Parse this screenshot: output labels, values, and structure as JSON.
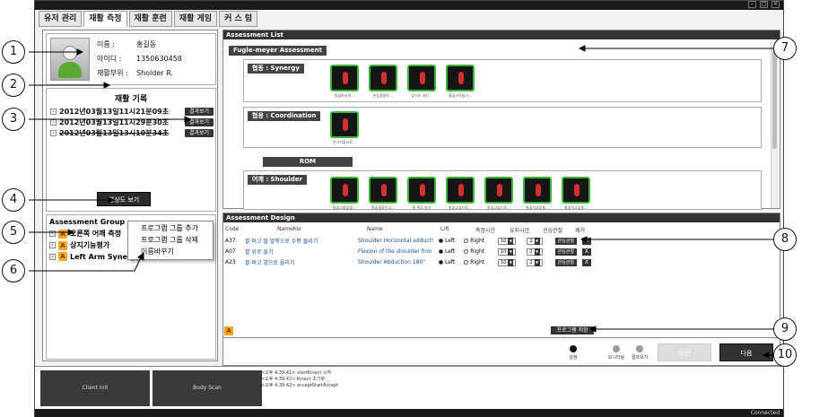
{
  "window": {
    "status": "Connected"
  },
  "tabs": [
    {
      "label": "유저 관리"
    },
    {
      "label": "재활 측정"
    },
    {
      "label": "재활 훈련"
    },
    {
      "label": "재활 게임"
    },
    {
      "label": "커 스 텀"
    }
  ],
  "profile": {
    "name_label": "이름 :",
    "name": "홍길동",
    "id_label": "아이디 :",
    "id": "1350630458",
    "part_label": "재활부위 :",
    "part": "Sholder R."
  },
  "records": {
    "title": "재활 기록",
    "items": [
      {
        "date": "2012년03월13일11시21분09초",
        "button": "결과보기"
      },
      {
        "date": "2012년03월13일11시29분30초",
        "button": "결과보기"
      },
      {
        "date": "2012년03월13일13시10분34초",
        "button": "결과보기"
      }
    ],
    "video_button": "영상도 보기"
  },
  "assessment_group": {
    "title": "Assessment Group",
    "items": [
      {
        "label": "오른쪽 어깨 측정"
      },
      {
        "label": "상지기능평가"
      },
      {
        "label": "Left Arm Synergy"
      }
    ],
    "context_menu": [
      "프로그램 그룹 추가",
      "프로그램 그룹 삭제",
      "이름바꾸기"
    ]
  },
  "assessment_list": {
    "title": "Assessment List",
    "fugl_meyer": "Fugle-meyer Assessment",
    "synergy": "협동 : Synergy",
    "synergy_items": [
      "팔꿈펴서펴…",
      "손등올렸모…",
      "앞으로 내민…",
      "팔꿈으로들기…"
    ],
    "coordination": "협응 : Coordination",
    "coordination_items": [
      "손가락을코로…"
    ],
    "rom": "ROM",
    "shoulder": "어깨 : Shoulder",
    "shoulder_items": [
      "팔꿈고을앞옆…",
      "팔꿈올을이고…",
      "팔 위로 들기",
      "팔꿈고앞으로…",
      "팔꿈고앞으로…",
      "팔꿈치고앞들…",
      "팔꿈치고앞들…"
    ]
  },
  "design": {
    "title": "Assessment Design",
    "headers": {
      "code": "Code",
      "kor": "NameKor",
      "name": "Name",
      "lr": "L/R",
      "measure": "측정시간",
      "hold": "유지시간",
      "interest": "관심관절",
      "remove": "제거"
    },
    "rows": [
      {
        "code": "A37",
        "kor": "팔 펴고  팔 앞쪽으로 수평 돌리기",
        "eng": "Shoulder Horizontal adduct!",
        "left": "Left",
        "right": "Right",
        "measure": "10",
        "hold": "2",
        "interest": "관심관절",
        "remove": "X"
      },
      {
        "code": "A07",
        "kor": "팔 위로 들기",
        "eng": "Flexion of the shoulder fron",
        "left": "Left",
        "right": "Right",
        "measure": "10",
        "hold": "2",
        "interest": "관심관절",
        "remove": "X"
      },
      {
        "code": "A23",
        "kor": "팔 펴고 옆으로 올리기",
        "eng": "Shoulder Abduction 180°",
        "left": "Left",
        "right": "Right",
        "measure": "10",
        "hold": "2",
        "interest": "관심관절",
        "remove": "X"
      }
    ],
    "save_button": "프로그램 저장"
  },
  "wizard": {
    "steps": [
      "설정",
      "모니터링",
      "결과보기"
    ],
    "prev": "이전",
    "next": "다음"
  },
  "bottom": {
    "client_init": "Client Init",
    "body_scan": "Body Scan",
    "log": [
      "<오후 4:39:42> startKinect 시작",
      "<오후 4:39:42> Kinect 초기화",
      "<오후 4:39:42> acceptStartAccept"
    ]
  },
  "callouts": [
    "1",
    "2",
    "3",
    "4",
    "5",
    "6",
    "7",
    "8",
    "9",
    "10"
  ]
}
